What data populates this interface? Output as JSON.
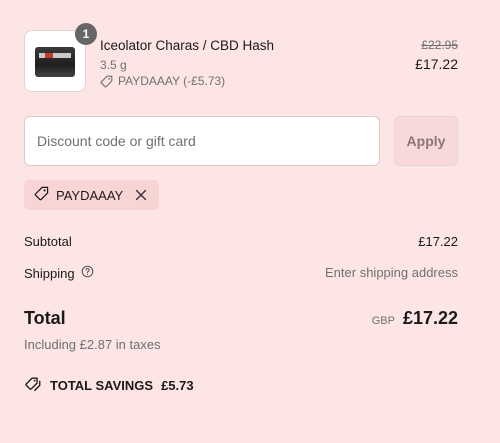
{
  "product": {
    "name": "Iceolator Charas / CBD Hash",
    "variant": "3.5 g",
    "discount_line": "PAYDAAAY (-£5.73)",
    "original_price": "£22.95",
    "price": "£17.22",
    "quantity": "1",
    "thumbnail_icon": "product-thumbnail"
  },
  "discount": {
    "placeholder": "Discount code or gift card",
    "value": "",
    "apply_label": "Apply",
    "applied_code": "PAYDAAAY"
  },
  "summary": {
    "subtotal_label": "Subtotal",
    "subtotal_value": "£17.22",
    "shipping_label": "Shipping",
    "shipping_value": "Enter shipping address",
    "total_label": "Total",
    "currency": "GBP",
    "total_value": "£17.22",
    "tax_note": "Including £2.87 in taxes",
    "savings_label": "TOTAL SAVINGS",
    "savings_value": "£5.73"
  },
  "colors": {
    "background": "#fde5e5",
    "chip_background": "#f9d4d4",
    "badge": "#666666"
  },
  "icons": {
    "tag": "tag-icon",
    "tags": "tags-icon",
    "remove": "close-icon",
    "help": "help-circle-icon"
  }
}
